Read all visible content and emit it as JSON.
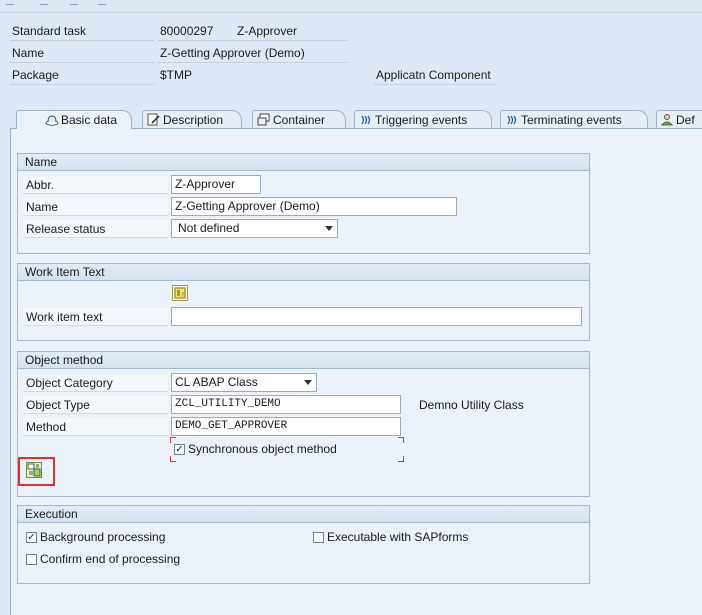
{
  "header": {
    "standard_task_label": "Standard task",
    "task_number": "80000297",
    "task_abbr": "Z-Approver",
    "name_label": "Name",
    "name_value": "Z-Getting Approver (Demo)",
    "package_label": "Package",
    "package_value": "$TMP",
    "app_component_label": "Applicatn Component"
  },
  "tabs": [
    {
      "label": "Basic data",
      "icon": "hat-icon"
    },
    {
      "label": "Description",
      "icon": "document-pen-icon"
    },
    {
      "label": "Container",
      "icon": "container-icon"
    },
    {
      "label": "Triggering events",
      "icon": "event-waves-icon"
    },
    {
      "label": "Terminating events",
      "icon": "event-waves-icon"
    },
    {
      "label": "Def",
      "icon": "agent-icon"
    }
  ],
  "name_group": {
    "title": "Name",
    "abbr_label": "Abbr.",
    "abbr_value": "Z-Approver",
    "name_label": "Name",
    "name_value": "Z-Getting Approver (Demo)",
    "release_label": "Release status",
    "release_value": "Not defined"
  },
  "work_item_group": {
    "title": "Work Item Text",
    "text_label": "Work item text",
    "text_value": ""
  },
  "object_method_group": {
    "title": "Object method",
    "category_label": "Object Category",
    "category_value": "CL ABAP Class",
    "type_label": "Object Type",
    "type_value": "ZCL_UTILITY_DEMO",
    "type_description": "Demno Utility Class",
    "method_label": "Method",
    "method_value": "DEMO_GET_APPROVER",
    "sync_label": "Synchronous object method",
    "sync_checked": true
  },
  "execution_group": {
    "title": "Execution",
    "background_label": "Background processing",
    "background_checked": true,
    "confirm_label": "Confirm end of processing",
    "confirm_checked": false,
    "sapforms_label": "Executable with SAPforms",
    "sapforms_checked": false
  },
  "colors": {
    "highlight_border": "#e0322c",
    "focus_corner": "#d23b3b"
  }
}
